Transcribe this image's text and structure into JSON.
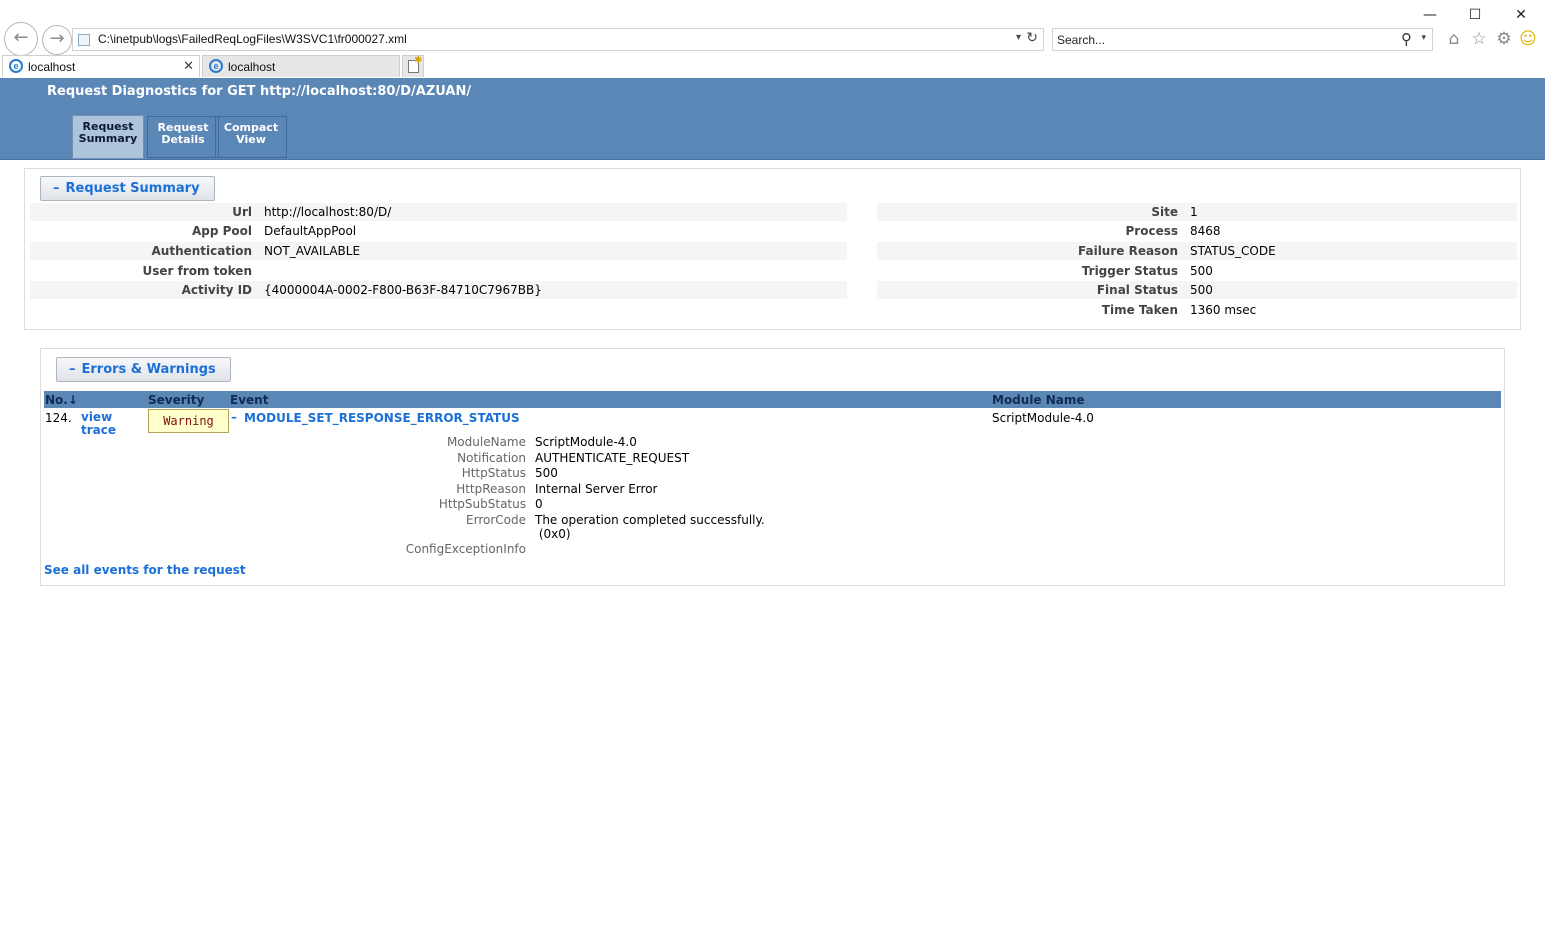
{
  "browser": {
    "address_url": "C:\\inetpub\\logs\\FailedReqLogFiles\\W3SVC1\\fr000027.xml",
    "search_placeholder": "Search...",
    "tabs": [
      {
        "label": "localhost"
      },
      {
        "label": "localhost"
      }
    ]
  },
  "header": {
    "title": "Request Diagnostics for GET http://localhost:80/D/AZUAN/",
    "tabs": [
      {
        "line1": "Request",
        "line2": "Summary"
      },
      {
        "line1": "Request",
        "line2": "Details"
      },
      {
        "line1": "Compact",
        "line2": "View"
      }
    ]
  },
  "summary": {
    "heading": "Request Summary",
    "left": [
      {
        "label": "Url",
        "value": "http://localhost:80/D/"
      },
      {
        "label": "App Pool",
        "value": "DefaultAppPool"
      },
      {
        "label": "Authentication",
        "value": "NOT_AVAILABLE"
      },
      {
        "label": "User from token",
        "value": ""
      },
      {
        "label": "Activity ID",
        "value": "{4000004A-0002-F800-B63F-84710C7967BB}"
      }
    ],
    "right": [
      {
        "label": "Site",
        "value": "1"
      },
      {
        "label": "Process",
        "value": "8468"
      },
      {
        "label": "Failure Reason",
        "value": "STATUS_CODE"
      },
      {
        "label": "Trigger Status",
        "value": "500"
      },
      {
        "label": "Final Status",
        "value": "500"
      },
      {
        "label": "Time Taken",
        "value": "1360 msec"
      }
    ]
  },
  "errors": {
    "heading": "Errors & Warnings",
    "columns": {
      "no": "No.↓",
      "severity": "Severity",
      "event": "Event",
      "module": "Module Name"
    },
    "row": {
      "no": "124.",
      "view_line1": "view",
      "view_line2": "trace",
      "severity": "Warning",
      "event": "MODULE_SET_RESPONSE_ERROR_STATUS",
      "module": "ScriptModule-4.0"
    },
    "details": [
      {
        "label": "ModuleName",
        "value": "ScriptModule-4.0"
      },
      {
        "label": "Notification",
        "value": "AUTHENTICATE_REQUEST"
      },
      {
        "label": "HttpStatus",
        "value": "500"
      },
      {
        "label": "HttpReason",
        "value": "Internal Server Error"
      },
      {
        "label": "HttpSubStatus",
        "value": "0"
      },
      {
        "label": "ErrorCode",
        "value": "The operation completed successfully."
      },
      {
        "label": "",
        "value": " (0x0)"
      },
      {
        "label": "ConfigExceptionInfo",
        "value": ""
      }
    ],
    "see_all": "See all events for the request"
  }
}
